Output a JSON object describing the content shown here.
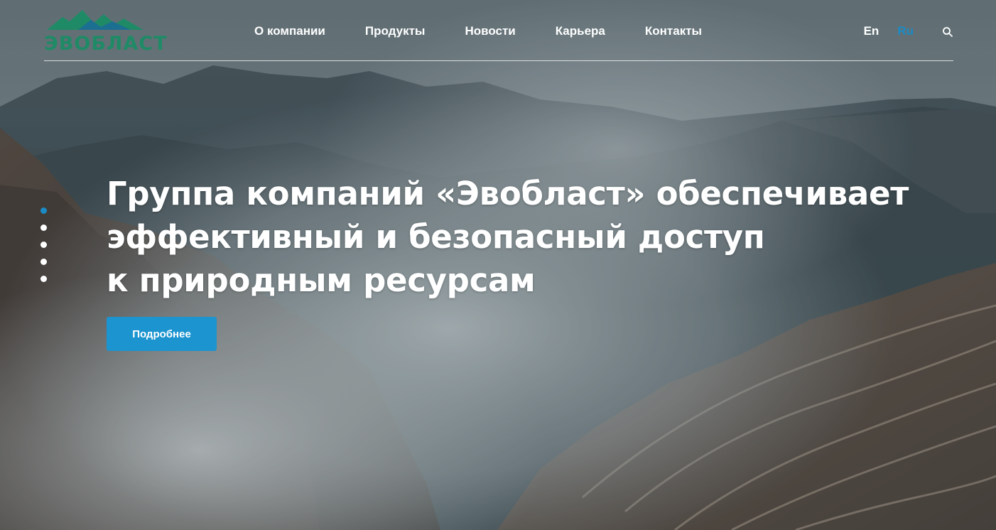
{
  "brand": {
    "logo_text": "ЭВОБЛАСТ",
    "logo_color": "#1f8a66"
  },
  "nav": {
    "items": [
      {
        "label": "О компании"
      },
      {
        "label": "Продукты"
      },
      {
        "label": "Новости"
      },
      {
        "label": "Карьера"
      },
      {
        "label": "Контакты"
      }
    ]
  },
  "language": {
    "en": "En",
    "ru": "Ru",
    "active": "Ru",
    "active_color": "#1b8ac4"
  },
  "search": {
    "icon": "search-icon"
  },
  "hero": {
    "headline_lines": [
      "Группа компаний «Эвобласт» обеспечивает",
      "эффективный и безопасный доступ",
      "к природным ресурсам"
    ],
    "cta_label": "Подробнее",
    "cta_color": "#1b94cf",
    "slides_count": 5,
    "active_slide": 1
  }
}
